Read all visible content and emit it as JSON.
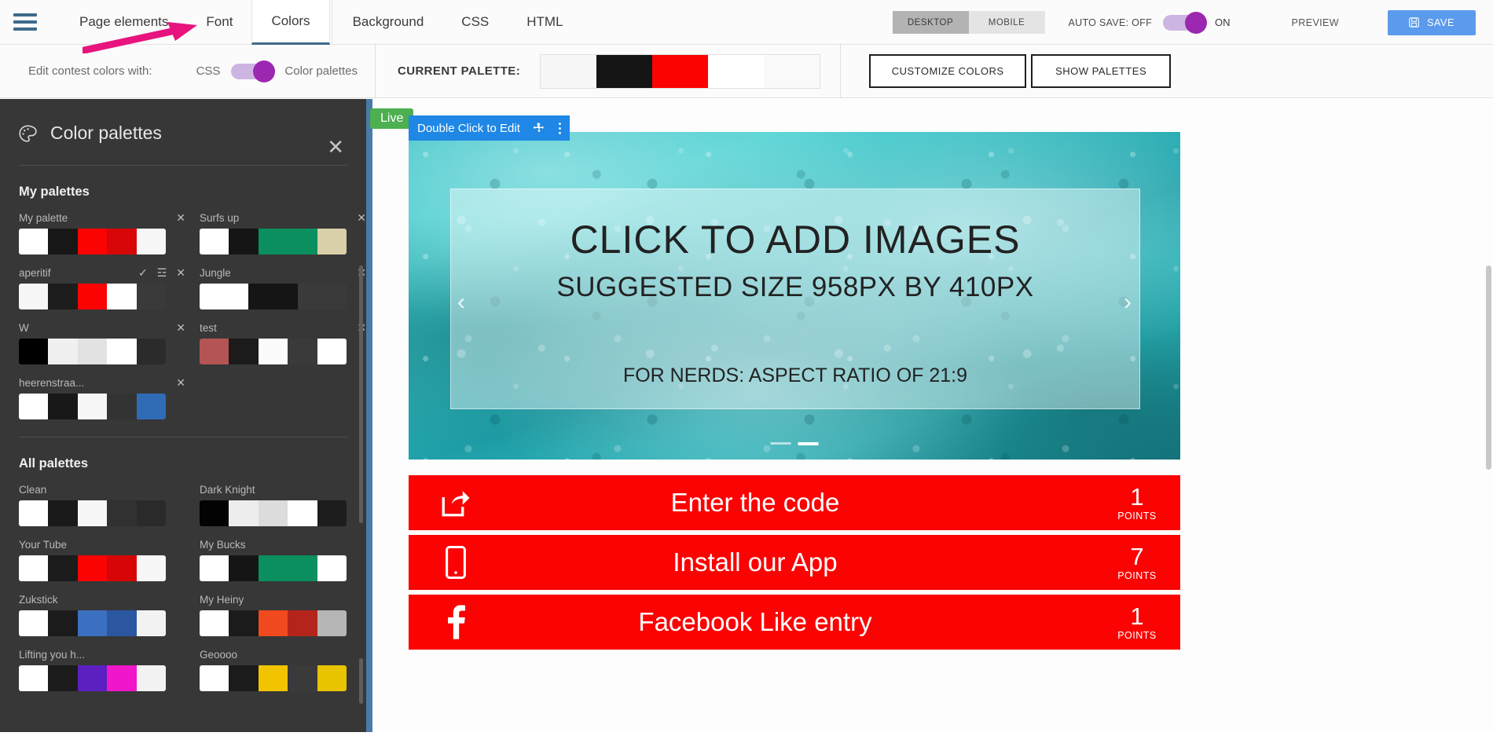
{
  "topbar": {
    "menu_icon": "hamburger-icon",
    "tabs": [
      {
        "label": "Page elements",
        "active": false
      },
      {
        "label": "Font",
        "active": false
      },
      {
        "label": "Colors",
        "active": true
      },
      {
        "label": "Background",
        "active": false
      },
      {
        "label": "CSS",
        "active": false
      },
      {
        "label": "HTML",
        "active": false
      }
    ],
    "device_toggle": {
      "desktop": "DESKTOP",
      "mobile": "MOBILE",
      "selected": "DESKTOP"
    },
    "autosave_label": "AUTO SAVE: OFF",
    "autosave_state": "ON",
    "preview_label": "PREVIEW",
    "save_label": "SAVE",
    "save_icon": "save-disk-icon",
    "accent_blue": "#5b9bed",
    "toggle_purple": "#9c27b0"
  },
  "subbar": {
    "edit_with_label": "Edit contest colors with:",
    "css_option": "CSS",
    "palettes_option": "Color palettes",
    "current_palette_label": "CURRENT PALETTE:",
    "current_palette_colors": [
      "#f7f7f7",
      "#151515",
      "#fb0303",
      "#ffffff",
      "#fafafa"
    ],
    "customize_colors_label": "CUSTOMIZE COLORS",
    "show_palettes_label": "SHOW PALETTES"
  },
  "panel": {
    "title": "Color palettes",
    "title_icon": "palette-icon",
    "close_icon": "close-icon",
    "my_palettes_heading": "My palettes",
    "all_palettes_heading": "All palettes",
    "my_palettes": [
      {
        "name": "My palette",
        "colors": [
          "#ffffff",
          "#171717",
          "#fb0303",
          "#d80707",
          "#f7f7f7"
        ],
        "icons": [
          "close-icon"
        ]
      },
      {
        "name": "Surfs up",
        "colors": [
          "#ffffff",
          "#151515",
          "#0b8f5f",
          "#0b8f5f",
          "#d9cfa8"
        ],
        "icons": [
          "close-icon"
        ]
      },
      {
        "name": "aperitif",
        "colors": [
          "#f7f7f7",
          "#1d1d1d",
          "#fb0303",
          "#ffffff",
          "#3a3a3a"
        ],
        "icons": [
          "check-icon",
          "sliders-icon",
          "close-icon"
        ],
        "selected": true
      },
      {
        "name": "Jungle",
        "colors": [
          "#ffffff",
          "#151515",
          "#f9a košice"
        ],
        "icons": [
          "close-icon"
        ]
      },
      {
        "name": "W",
        "colors": [
          "#000000",
          "#f0f0f0",
          "#e2e2e2",
          "#ffffff",
          "#2b2b2b"
        ],
        "icons": [
          "close-icon"
        ]
      },
      {
        "name": "test",
        "colors": [
          "#b45454",
          "#1b1b1b",
          "#fbfbfb",
          "#3a3a3a",
          "#ffffff"
        ],
        "icons": [
          "close-icon"
        ]
      },
      {
        "name": "heerenstraa...",
        "colors": [
          "#ffffff",
          "#181818",
          "#f7f7f7",
          "#333333",
          "#2f6cb5"
        ],
        "icons": [
          "close-icon"
        ]
      }
    ],
    "all_palettes": [
      {
        "name": "Clean",
        "colors": [
          "#ffffff",
          "#1a1a1a",
          "#f7f7f7",
          "#313131",
          "#2a2a2a"
        ]
      },
      {
        "name": "Dark Knight",
        "colors": [
          "#030303",
          "#ededed",
          "#dcdcdc",
          "#ffffff",
          "#1d1d1d"
        ]
      },
      {
        "name": "Your Tube",
        "colors": [
          "#ffffff",
          "#1b1b1b",
          "#fb0303",
          "#d70606",
          "#f7f7f7"
        ]
      },
      {
        "name": "My Bucks",
        "colors": [
          "#ffffff",
          "#151515",
          "#0b8f5f",
          "#0b8f5f",
          "#ffffff"
        ]
      },
      {
        "name": "Zukstick",
        "colors": [
          "#ffffff",
          "#1b1b1b",
          "#3b6fbf",
          "#2a57a0",
          "#f2f2f2"
        ]
      },
      {
        "name": "My Heiny",
        "colors": [
          "#ffffff",
          "#1b1b1b",
          "#f04a1e",
          "#b4241a",
          "#b6b6b6"
        ]
      },
      {
        "name": "Lifting you h...",
        "colors": [
          "#ffffff",
          "#1b1b1b",
          "#5c1fc0",
          "#ef17c9",
          "#f2f2f2"
        ]
      },
      {
        "name": "Geoooo",
        "colors": [
          "#ffffff",
          "#1b1b1b",
          "#f2c400",
          "#3a3a3a",
          "#e9c400"
        ]
      }
    ]
  },
  "canvas": {
    "live_badge": "Live",
    "edit_bar_label": "Double Click to Edit",
    "edit_bar_move_icon": "move-icon",
    "edit_bar_menu_icon": "kebab-menu-icon",
    "hero": {
      "line1": "CLICK TO ADD IMAGES",
      "line2": "SUGGESTED SIZE 958PX  BY 410PX",
      "line3": "FOR NERDS: ASPECT RATIO OF 21:9",
      "prev_icon": "chevron-left-icon",
      "next_icon": "chevron-right-icon"
    },
    "actions": [
      {
        "icon": "share-icon",
        "title": "Enter the code",
        "points": "1",
        "points_label": "POINTS"
      },
      {
        "icon": "mobile-icon",
        "title": "Install our App",
        "points": "7",
        "points_label": "POINTS"
      },
      {
        "icon": "facebook-icon",
        "title": "Facebook Like entry",
        "points": "1",
        "points_label": "POINTS"
      }
    ],
    "action_color": "#fb0303"
  }
}
